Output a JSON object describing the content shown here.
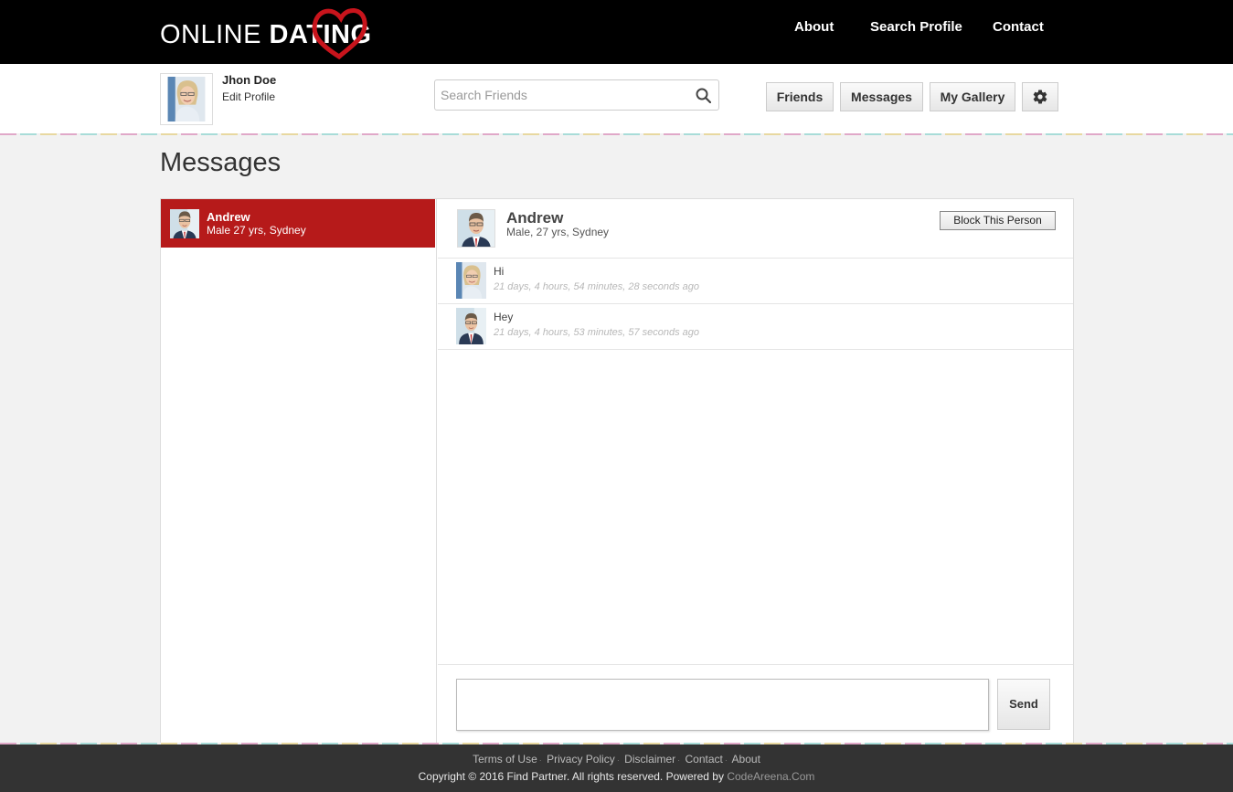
{
  "brand": {
    "light": "ONLINE",
    "bold": "DATING"
  },
  "topnav": [
    "About",
    "Search Profile",
    "Contact"
  ],
  "user": {
    "name": "Jhon Doe",
    "edit_label": "Edit Profile"
  },
  "search": {
    "placeholder": "Search Friends"
  },
  "nav_buttons": {
    "friends": "Friends",
    "messages": "Messages",
    "gallery": "My Gallery",
    "settings_icon": "gear-icon"
  },
  "page_title": "Messages",
  "conversations": [
    {
      "name": "Andrew",
      "info": "Male 27 yrs, Sydney"
    }
  ],
  "chat": {
    "name": "Andrew",
    "info": "Male, 27 yrs, Sydney",
    "block_label": "Block This Person",
    "messages": [
      {
        "text": "Hi",
        "time": "21 days, 4 hours, 54 minutes, 28 seconds ago",
        "sender": "self"
      },
      {
        "text": "Hey",
        "time": "21 days, 4 hours, 53 minutes, 57 seconds ago",
        "sender": "other"
      }
    ],
    "compose_value": "",
    "send_label": "Send"
  },
  "footer": {
    "links": [
      "Terms of Use",
      "Privacy Policy",
      "Disclaimer",
      "Contact",
      "About"
    ],
    "copyright": "Copyright © 2016 Find Partner. All rights reserved. Powered by",
    "powered_by": "CodeAreena.Com"
  },
  "colors": {
    "accent": "#b61a1a",
    "topbar": "#000000",
    "footer": "#333333"
  }
}
